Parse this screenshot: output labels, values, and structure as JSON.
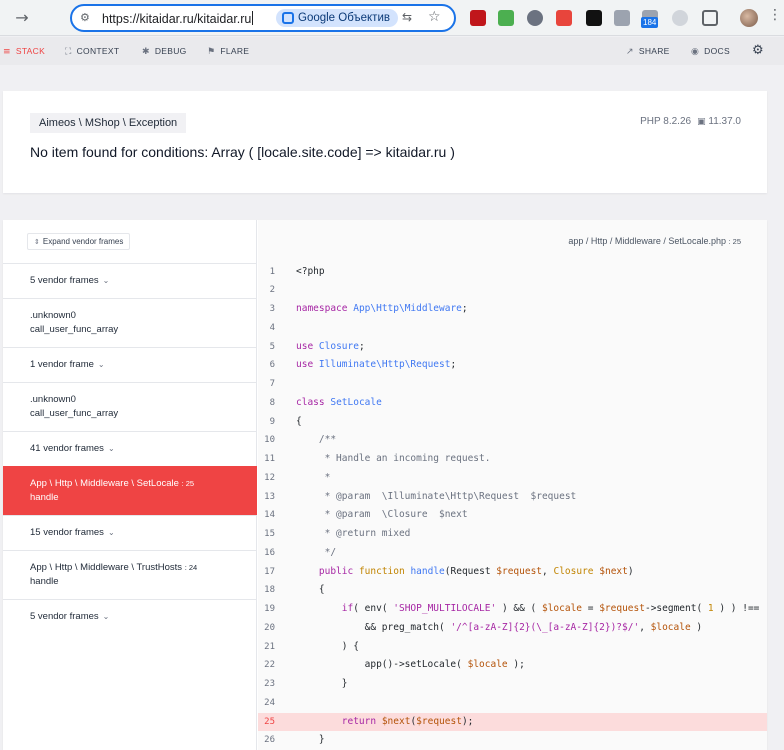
{
  "browser": {
    "url": "https://kitaidar.ru/kitaidar.ru",
    "lens_label": "Google Объектив",
    "badge_count": "184"
  },
  "nav": {
    "stack": "STACK",
    "context": "CONTEXT",
    "debug": "DEBUG",
    "flare": "FLARE",
    "share": "SHARE",
    "docs": "DOCS"
  },
  "exception": {
    "class": "Aimeos \\ MShop \\ Exception",
    "message": "No item found for conditions: Array ( [locale.site.code] => kitaidar.ru )",
    "php_version": "PHP 8.2.26",
    "laravel_version": "11.37.0"
  },
  "frames": {
    "expand_label": "Expand vendor frames",
    "items": [
      {
        "kind": "vendor",
        "label": "5 vendor frames"
      },
      {
        "kind": "app",
        "file": ".unknown0",
        "method": "call_user_func_array",
        "line": ""
      },
      {
        "kind": "vendor",
        "label": "1 vendor frame"
      },
      {
        "kind": "app",
        "file": ".unknown0",
        "method": "call_user_func_array",
        "line": ""
      },
      {
        "kind": "vendor",
        "label": "41 vendor frames"
      },
      {
        "kind": "app",
        "file": "App \\ Http \\ Middleware \\ SetLocale",
        "method": "handle",
        "line": ": 25",
        "selected": true
      },
      {
        "kind": "vendor",
        "label": "15 vendor frames"
      },
      {
        "kind": "app",
        "file": "App \\ Http \\ Middleware \\ TrustHosts",
        "method": "handle",
        "line": ": 24"
      },
      {
        "kind": "vendor",
        "label": "5 vendor frames"
      }
    ]
  },
  "code": {
    "file_path": "app / Http / Middleware / SetLocale.php",
    "file_line": ": 25",
    "highlight_line": 25,
    "lines": [
      {
        "n": "1",
        "html": "&lt;?php"
      },
      {
        "n": "2",
        "html": ""
      },
      {
        "n": "3",
        "html": "<span class=\"kw\">namespace</span> <span class=\"cls\">App\\Http\\Middleware</span>;"
      },
      {
        "n": "4",
        "html": ""
      },
      {
        "n": "5",
        "html": "<span class=\"kw\">use</span> <span class=\"cls\">Closure</span>;"
      },
      {
        "n": "6",
        "html": "<span class=\"kw\">use</span> <span class=\"cls\">Illuminate\\Http\\Request</span>;"
      },
      {
        "n": "7",
        "html": ""
      },
      {
        "n": "8",
        "html": "<span class=\"kw\">class</span> <span class=\"cls\">SetLocale</span>"
      },
      {
        "n": "9",
        "html": "{"
      },
      {
        "n": "10",
        "html": "    <span class=\"cm\">/**</span>"
      },
      {
        "n": "11",
        "html": "<span class=\"cm\">     * Handle an incoming request.</span>"
      },
      {
        "n": "12",
        "html": "<span class=\"cm\">     *</span>"
      },
      {
        "n": "13",
        "html": "<span class=\"cm\">     * @param  \\Illuminate\\Http\\Request  $request</span>"
      },
      {
        "n": "14",
        "html": "<span class=\"cm\">     * @param  \\Closure  $next</span>"
      },
      {
        "n": "15",
        "html": "<span class=\"cm\">     * @return mixed</span>"
      },
      {
        "n": "16",
        "html": "<span class=\"cm\">     */</span>"
      },
      {
        "n": "17",
        "html": "    <span class=\"kw\">public</span> <span class=\"typ\">function</span> <span class=\"fn\">handle</span>(Request <span class=\"var\">$request</span>, <span class=\"typ\">Closure</span> <span class=\"var\">$next</span>)"
      },
      {
        "n": "18",
        "html": "    {"
      },
      {
        "n": "19",
        "html": "        <span class=\"kw\">if</span>( env( <span class=\"str\">'SHOP_MULTILOCALE'</span> ) &amp;&amp; ( <span class=\"var\">$locale</span> = <span class=\"var\">$request</span>-&gt;segment( <span class=\"typ\">1</span> ) ) !=="
      },
      {
        "n": "20",
        "html": "            &amp;&amp; preg_match( <span class=\"str\">'/^[a-zA-Z]{2}(\\_[a-zA-Z]{2})?$/'</span>, <span class=\"var\">$locale</span> )"
      },
      {
        "n": "21",
        "html": "        ) {"
      },
      {
        "n": "22",
        "html": "            app()-&gt;setLocale( <span class=\"var\">$locale</span> );"
      },
      {
        "n": "23",
        "html": "        }"
      },
      {
        "n": "24",
        "html": ""
      },
      {
        "n": "25",
        "html": "        <span class=\"kw\">return</span> <span class=\"var\">$next</span>(<span class=\"var\">$request</span>);"
      },
      {
        "n": "26",
        "html": "    }"
      }
    ]
  }
}
